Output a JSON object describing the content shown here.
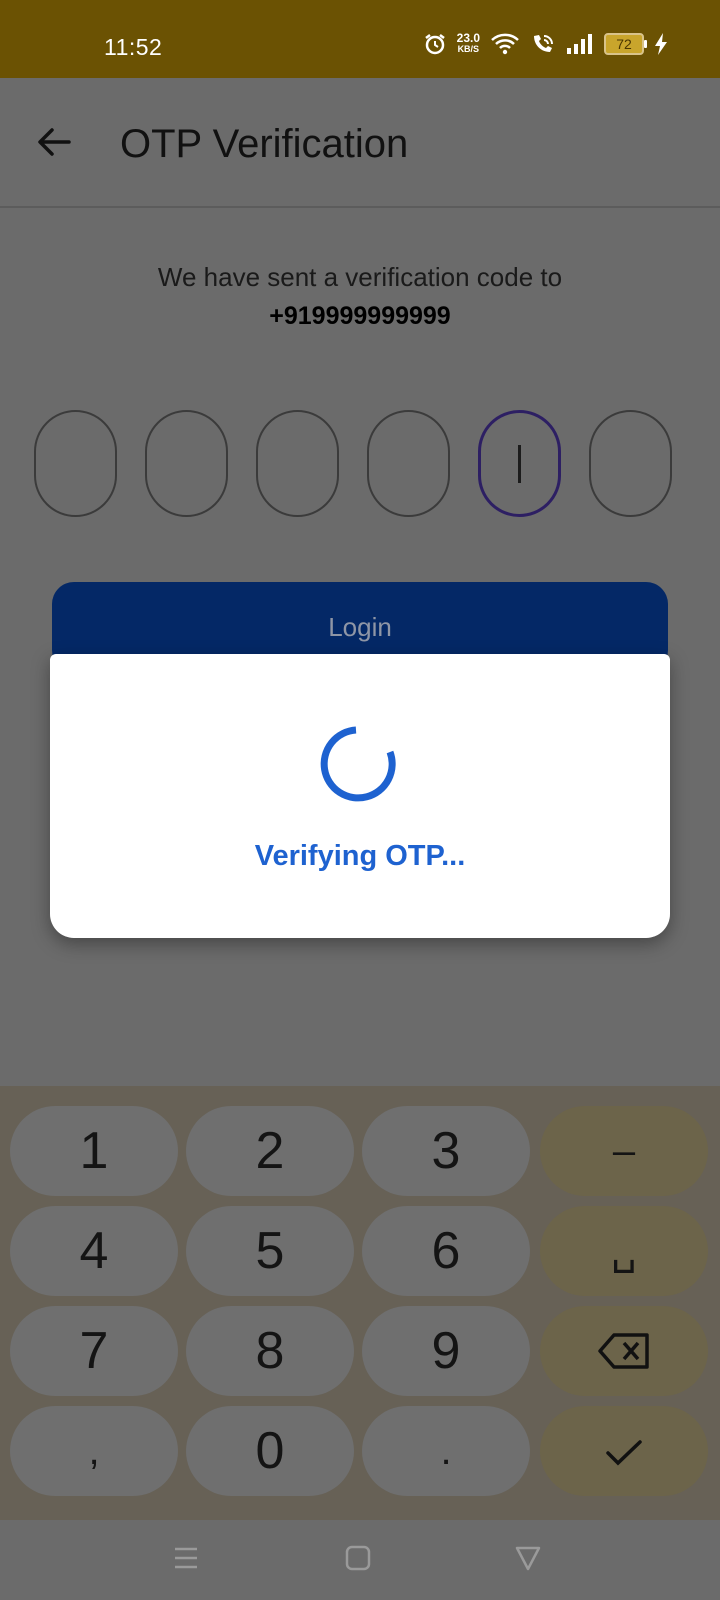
{
  "status_bar": {
    "time": "11:52",
    "speed_value": "23.0",
    "speed_unit": "KB/S",
    "battery": "72",
    "icons": [
      "alarm-icon",
      "wifi-icon",
      "wifi-calling-icon",
      "signal-icon",
      "battery-icon",
      "charging-icon"
    ]
  },
  "header": {
    "title": "OTP Verification",
    "back_icon": "arrow-left-icon"
  },
  "verification": {
    "instruction": "We have sent a verification code to",
    "phone": "+919999999999"
  },
  "otp": {
    "digits": [
      "",
      "",
      "",
      "",
      "",
      ""
    ],
    "active_index": 4
  },
  "login_label": "Login",
  "dialog": {
    "message": "Verifying OTP...",
    "accent": "#1e62d0"
  },
  "keyboard": {
    "rows": [
      [
        "1",
        "2",
        "3",
        "–"
      ],
      [
        "4",
        "5",
        "6",
        "␣"
      ],
      [
        "7",
        "8",
        "9",
        "backspace"
      ],
      [
        ",",
        "0",
        ".",
        "done"
      ]
    ]
  },
  "nav": {
    "icons": [
      "menu-icon",
      "home-icon",
      "back-triangle-icon"
    ]
  },
  "colors": {
    "status_bar": "#6b5203",
    "login_button": "#042866",
    "keyboard": "#676156"
  }
}
